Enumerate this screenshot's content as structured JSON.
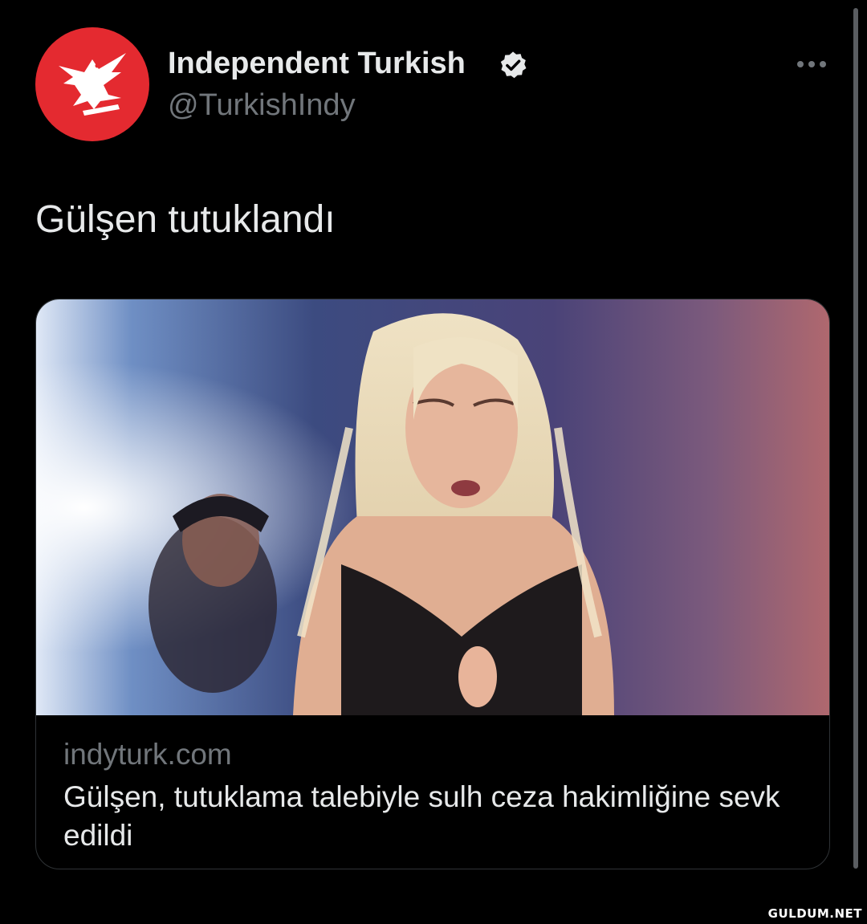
{
  "account": {
    "display_name": "Independent Turkish",
    "handle": "@TurkishIndy",
    "verified": true,
    "avatar_icon": "independent-eagle-icon",
    "avatar_color": "#e42a30"
  },
  "more_icon": "ellipsis-icon",
  "tweet": {
    "text": "Gülşen tutuklandı"
  },
  "link_card": {
    "image_desc_icon": "article-photo",
    "domain": "indyturk.com",
    "title": "Gülşen, tutuklama talebiyle sulh ceza hakimliğine sevk edildi"
  },
  "watermark": "GULDUM.NET",
  "colors": {
    "background": "#000000",
    "text": "#e7e9ea",
    "secondary_text": "#71767b",
    "card_border": "#2f3336"
  }
}
